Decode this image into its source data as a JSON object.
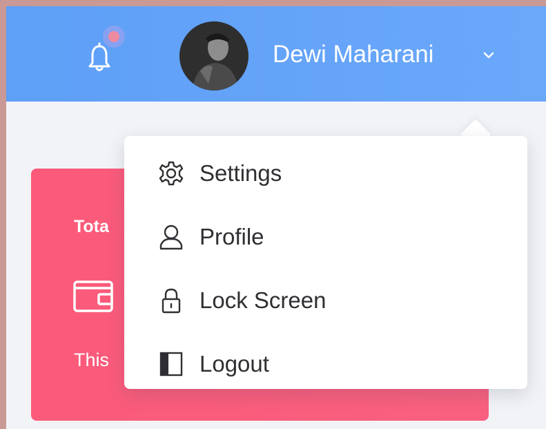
{
  "header": {
    "user_name": "Dewi Maharani",
    "notification_icon": "bell-icon",
    "dropdown_icon": "chevron-down-icon",
    "accent_color": "#64a4f8",
    "badge_color": "#f08aa0"
  },
  "card": {
    "title": "Tota",
    "subtitle": "This",
    "icon": "wallet-icon",
    "color": "#fb5a7a"
  },
  "dropdown": {
    "items": [
      {
        "label": "Settings",
        "icon": "gear-icon"
      },
      {
        "label": "Profile",
        "icon": "user-icon"
      },
      {
        "label": "Lock Screen",
        "icon": "lock-icon"
      },
      {
        "label": "Logout",
        "icon": "logout-icon"
      }
    ]
  }
}
